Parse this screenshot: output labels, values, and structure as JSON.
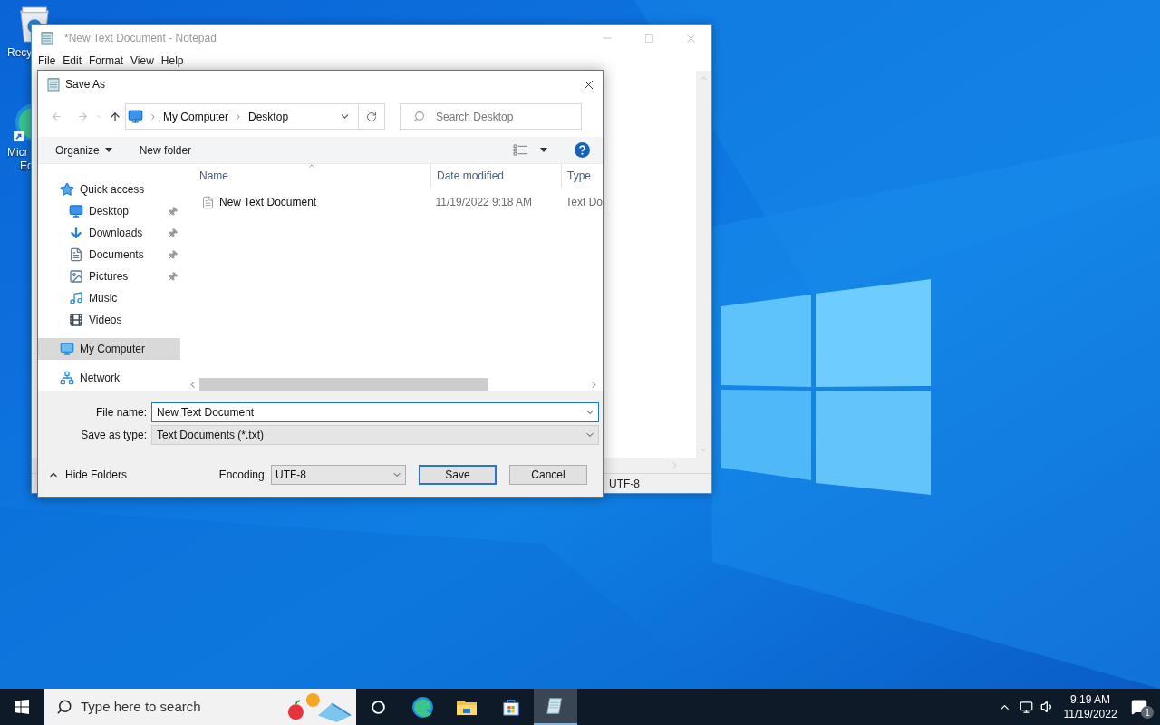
{
  "desktop_icons": [
    {
      "kind": "recycle-bin",
      "lines": [
        "Recy"
      ]
    },
    {
      "kind": "edge",
      "lines": [
        "Micr",
        "Ec"
      ]
    }
  ],
  "notepad": {
    "title": "*New Text Document - Notepad",
    "menu": [
      "File",
      "Edit",
      "Format",
      "View",
      "Help"
    ],
    "status_bar": [
      "UTF-8"
    ]
  },
  "dialog": {
    "title": "Save As",
    "breadcrumb": [
      "My Computer",
      "Desktop"
    ],
    "search": {
      "placeholder": "Search Desktop"
    },
    "toolbar": {
      "organize": "Organize",
      "new_folder": "New folder"
    },
    "nav": [
      {
        "label": "Quick access",
        "kind": "star",
        "selected": false,
        "children": [
          {
            "label": "Desktop",
            "kind": "desktop",
            "pinned": true,
            "selected": false
          },
          {
            "label": "Downloads",
            "kind": "download",
            "pinned": true,
            "selected": false
          },
          {
            "label": "Documents",
            "kind": "document",
            "pinned": true,
            "selected": false
          },
          {
            "label": "Pictures",
            "kind": "picture",
            "pinned": true,
            "selected": false
          },
          {
            "label": "Music",
            "kind": "music",
            "pinned": false,
            "selected": false
          },
          {
            "label": "Videos",
            "kind": "video",
            "pinned": false,
            "selected": false
          }
        ]
      },
      {
        "label": "My Computer",
        "kind": "computer",
        "selected": true
      },
      {
        "label": "Network",
        "kind": "network",
        "selected": false
      }
    ],
    "columns": [
      {
        "label": "Name",
        "sorted": true
      },
      {
        "label": "Date modified",
        "sorted": false
      },
      {
        "label": "Type",
        "sorted": false
      }
    ],
    "files": [
      {
        "cells": [
          "New Text Document",
          "11/19/2022 9:18 AM",
          "Text Do"
        ]
      }
    ],
    "file_name": {
      "label": "File name:",
      "value": "New Text Document"
    },
    "save_as_type": {
      "label": "Save as type:",
      "value": "Text Documents (*.txt)"
    },
    "hide_folders": "Hide Folders",
    "encoding": {
      "label": "Encoding:",
      "value": "UTF-8"
    },
    "buttons": [
      {
        "label": "Save",
        "default": true
      },
      {
        "label": "Cancel",
        "default": false
      }
    ]
  },
  "taskbar": {
    "search": {
      "placeholder": "Type here to search"
    },
    "apps": [
      {
        "kind": "cortana",
        "selected": false
      },
      {
        "kind": "edge",
        "selected": false
      },
      {
        "kind": "explorer",
        "selected": false
      },
      {
        "kind": "store",
        "selected": false
      },
      {
        "kind": "notepad",
        "selected": true
      }
    ],
    "clock": {
      "time": "9:19 AM",
      "date": "11/19/2022"
    },
    "notification_count": "1"
  }
}
